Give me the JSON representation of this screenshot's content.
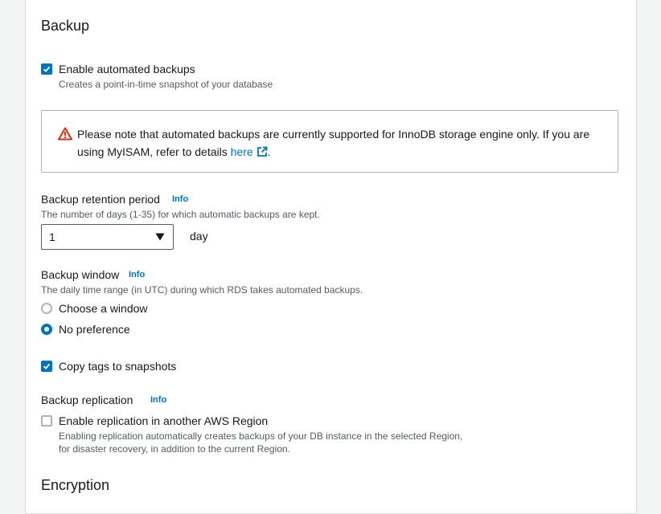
{
  "backup": {
    "title": "Backup",
    "enable_automated": {
      "label": "Enable automated backups",
      "description": "Creates a point-in-time snapshot of your database",
      "checked": true
    },
    "alert": {
      "text_before_link": "Please note that automated backups are currently supported for InnoDB storage engine only. If you are using MyISAM, refer to details ",
      "link_text": "here",
      "text_after_link": ".",
      "icon": "warning-icon",
      "external_icon": "external-link-icon"
    },
    "retention": {
      "label": "Backup retention period",
      "info": "Info",
      "description": "The number of days (1-35) for which automatic backups are kept.",
      "value": "1",
      "unit": "day"
    },
    "window": {
      "label": "Backup window",
      "info": "Info",
      "description": "The daily time range (in UTC) during which RDS takes automated backups.",
      "options": [
        {
          "label": "Choose a window",
          "selected": false
        },
        {
          "label": "No preference",
          "selected": true
        }
      ]
    },
    "copy_tags": {
      "label": "Copy tags to snapshots",
      "checked": true
    },
    "replication": {
      "label": "Backup replication",
      "info": "Info",
      "enable_label": "Enable replication in another AWS Region",
      "checked": false,
      "description_line1": "Enabling replication automatically creates backups of your DB instance in the selected Region,",
      "description_line2": "for disaster recovery, in addition to the current Region."
    }
  },
  "next_section": {
    "title": "Encryption"
  },
  "colors": {
    "accent": "#0073bb",
    "warning": "#d13212",
    "text": "#16191f",
    "muted": "#545b64"
  }
}
